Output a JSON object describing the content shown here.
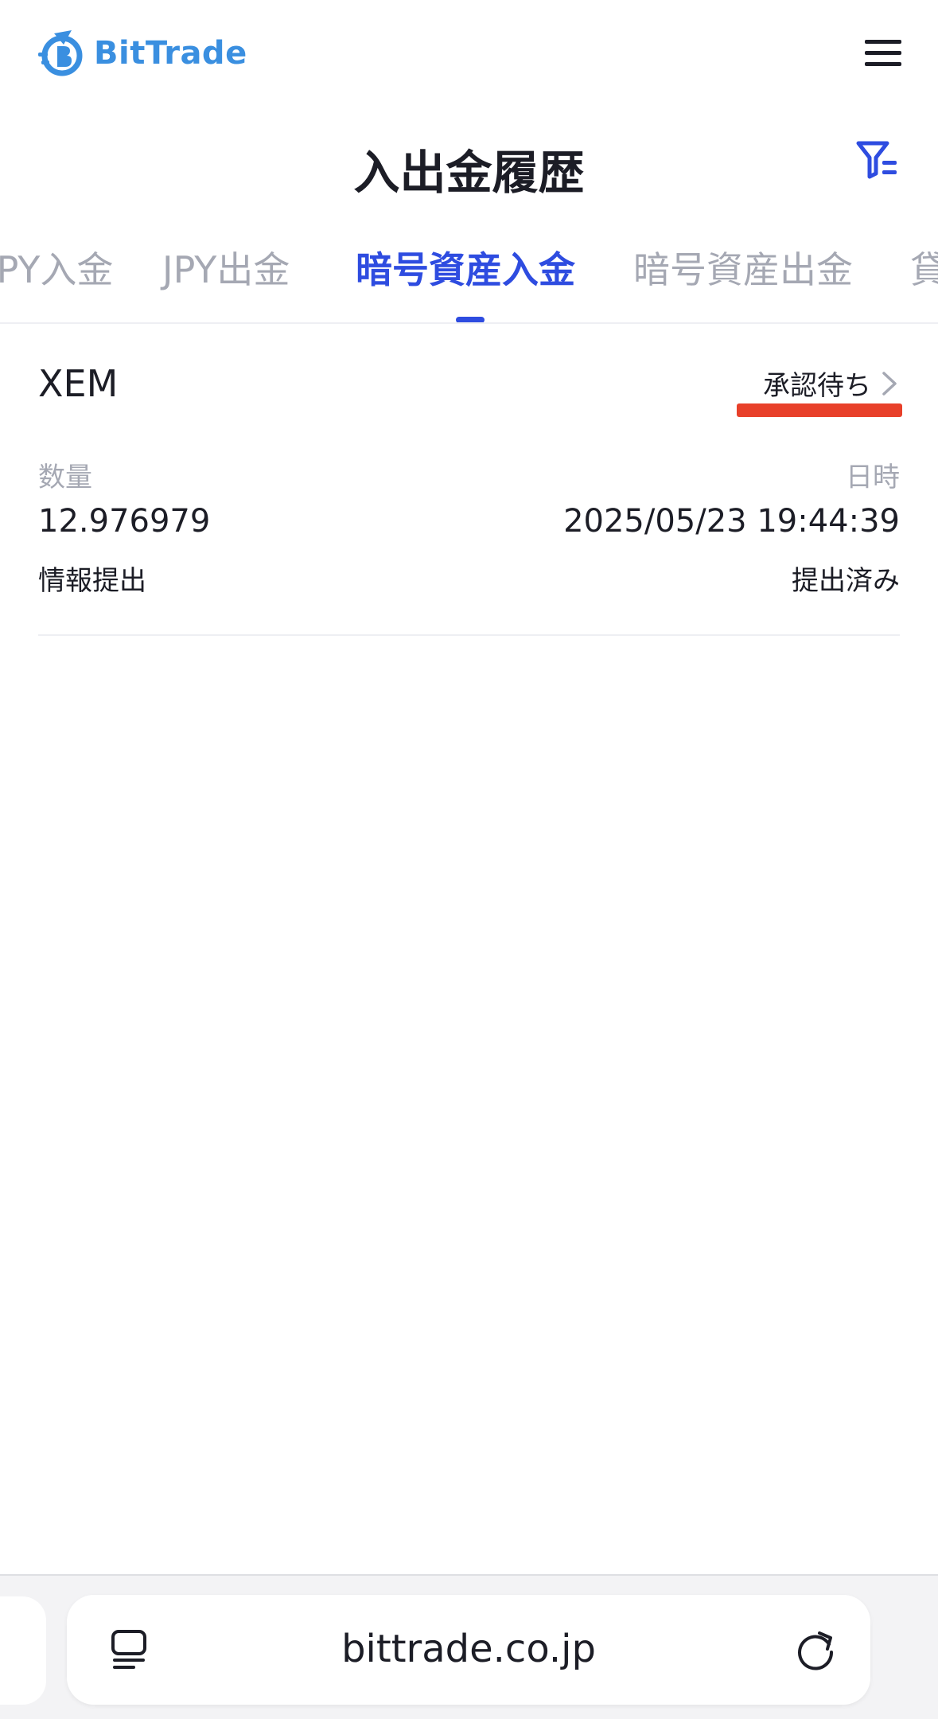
{
  "header": {
    "logo_text": "BitTrade",
    "logo_icon": "bittrade-logo-icon",
    "menu_icon": "hamburger-menu-icon"
  },
  "page": {
    "title": "入出金履歴",
    "filter_icon": "filter-icon"
  },
  "tabs": [
    {
      "label": "JPY入金",
      "active": false
    },
    {
      "label": "JPY出金",
      "active": false
    },
    {
      "label": "暗号資産入金",
      "active": true
    },
    {
      "label": "暗号資産出金",
      "active": false
    },
    {
      "label": "貸",
      "active": false
    }
  ],
  "record": {
    "asset": "XEM",
    "status": "承認待ち",
    "amount_label": "数量",
    "amount": "12.976979",
    "datetime_label": "日時",
    "datetime": "2025/05/23 19:44:39",
    "info_label": "情報提出",
    "info_status": "提出済み"
  },
  "browser": {
    "url": "bittrade.co.jp",
    "reader_icon": "reader-mode-icon",
    "reload_icon": "reload-icon"
  },
  "colors": {
    "accent": "#2e4ce0",
    "logo": "#3a8fe0",
    "highlight": "#e8402a",
    "muted": "#a5a8b3"
  }
}
